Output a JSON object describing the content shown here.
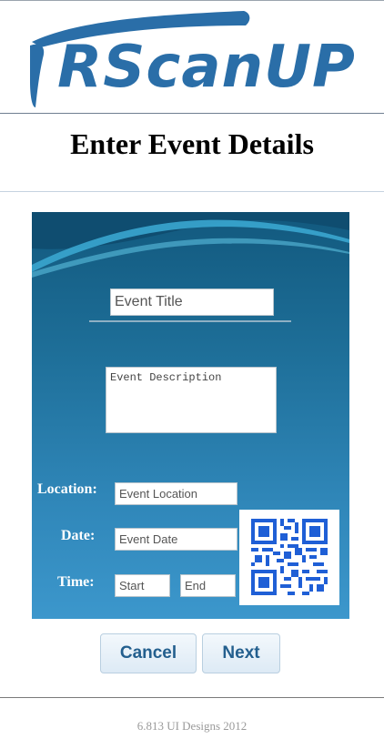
{
  "app": {
    "logo_text": "RScanUP"
  },
  "header": {
    "title": "Enter Event Details"
  },
  "form": {
    "title_placeholder": "Event Title",
    "description_placeholder": "Event Description",
    "location_label": "Location:",
    "location_placeholder": "Event Location",
    "date_label": "Date:",
    "date_placeholder": "Event Date",
    "time_label": "Time:",
    "start_placeholder": "Start",
    "end_placeholder": "End"
  },
  "actions": {
    "cancel_label": "Cancel",
    "next_label": "Next"
  },
  "footer": {
    "text": "6.813 UI Designs 2012"
  },
  "icons": {
    "logo": "rscanup-logo-swoosh-icon",
    "qr": "qr-code-icon"
  },
  "colors": {
    "brand": "#2a6ea8",
    "panel_top": "#12597e",
    "panel_bottom": "#3c97cc",
    "button_text": "#235f8e",
    "qr": "#1f5fd6"
  }
}
